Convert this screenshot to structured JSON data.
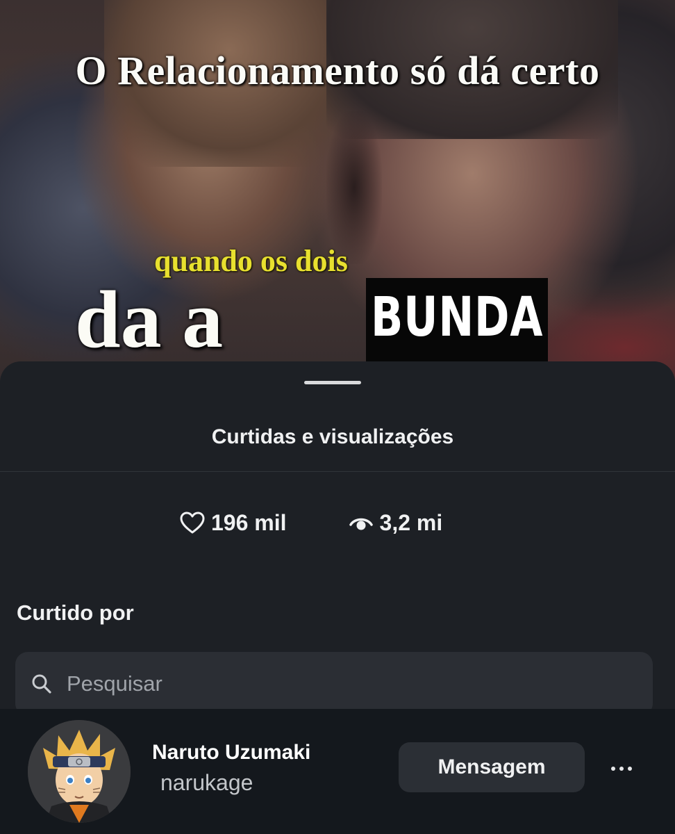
{
  "meme": {
    "top_text": "O Relacionamento só dá certo",
    "mid_text": "quando os dois",
    "big_text": "da a",
    "block_text": "BUNDA"
  },
  "sheet": {
    "title": "Curtidas e visualizações",
    "stats": {
      "likes_icon": "heart-icon",
      "likes": "196 mil",
      "views_icon": "eye-icon",
      "views": "3,2 mi"
    },
    "section_title": "Curtido por",
    "search": {
      "icon": "search-icon",
      "placeholder": "Pesquisar"
    },
    "user": {
      "name": "Naruto Uzumaki",
      "handle": "narukage",
      "message_button": "Mensagem",
      "more_icon": "more-dots-icon"
    }
  },
  "colors": {
    "sheet_background": "#1d2025",
    "search_background": "#2b2e34",
    "user_row_background": "#14181d",
    "meme_yellow_text": "#e8e02f"
  }
}
